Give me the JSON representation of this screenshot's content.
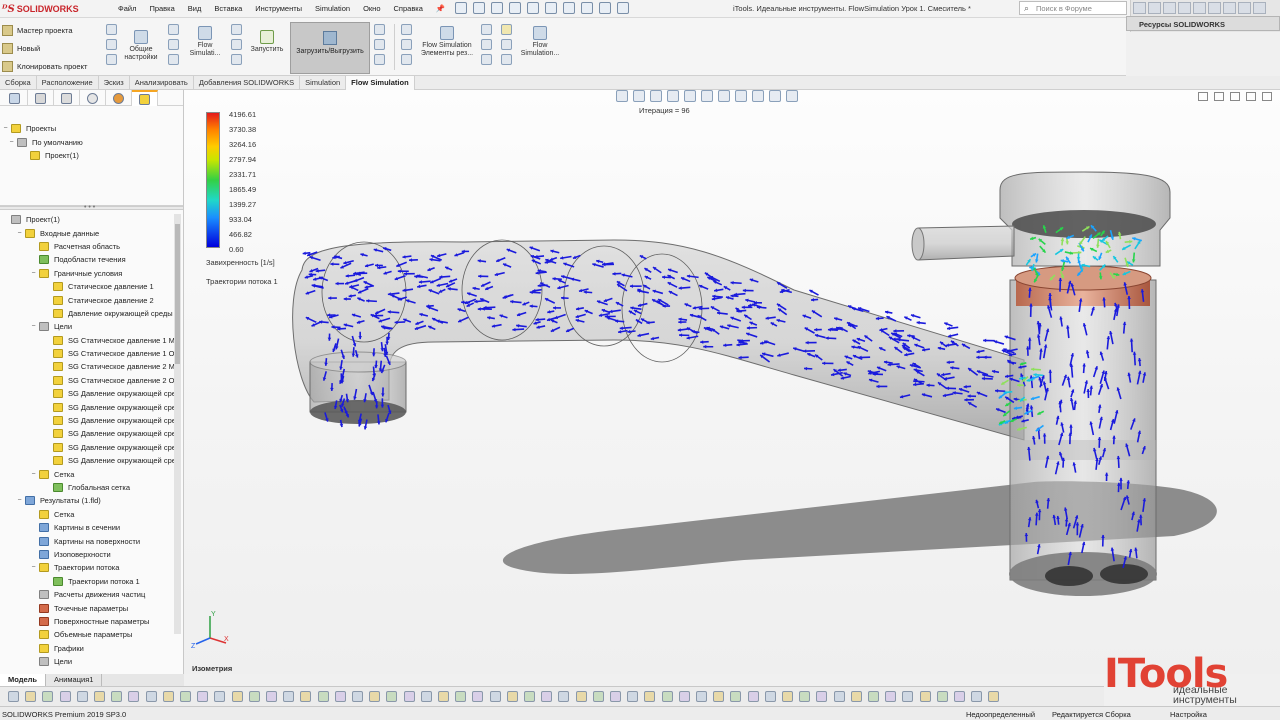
{
  "app": {
    "brand": "SOLIDWORKS",
    "window_title": "iTools. Идеальные инструменты. FlowSimulation Урок 1. Смеситель *"
  },
  "menu": [
    "Файл",
    "Правка",
    "Вид",
    "Вставка",
    "Инструменты",
    "Simulation",
    "Окно",
    "Справка"
  ],
  "search": {
    "placeholder": "Поиск в Форуме"
  },
  "resources_panel": {
    "label": "Ресурсы SOLIDWORKS"
  },
  "command_manager": {
    "left_commands": [
      "Мастер проекта",
      "Новый",
      "Клонировать проект"
    ],
    "general_settings": "Общие настройки",
    "flow_simulation": "Flow Simulati...",
    "run": "Запустить",
    "load_unload": "Загрузить/Выгрузить",
    "result_elements": "Flow Simulation Элементы рез...",
    "flow_simulation_2": "Flow Simulation..."
  },
  "tabs": [
    "Сборка",
    "Расположение",
    "Эскиз",
    "Анализировать",
    "Добавления SOLIDWORKS",
    "Simulation",
    "Flow Simulation"
  ],
  "active_tab": "Flow Simulation",
  "projects_panel": {
    "root": "Проекты",
    "default": "По умолчанию",
    "project": "Проект(1)"
  },
  "project_tree": [
    {
      "label": "Проект(1)",
      "level": 0,
      "icon": "gry",
      "exp": ""
    },
    {
      "label": "Входные данные",
      "level": 1,
      "icon": "yel",
      "exp": "−"
    },
    {
      "label": "Расчетная область",
      "level": 2,
      "icon": "yel",
      "exp": ""
    },
    {
      "label": "Подобласти течения",
      "level": 2,
      "icon": "grn",
      "exp": ""
    },
    {
      "label": "Граничные условия",
      "level": 2,
      "icon": "yel",
      "exp": "−"
    },
    {
      "label": "Статическое давление 1",
      "level": 3,
      "icon": "yel",
      "exp": ""
    },
    {
      "label": "Статическое давление 2",
      "level": 3,
      "icon": "yel",
      "exp": ""
    },
    {
      "label": "Давление окружающей среды",
      "level": 3,
      "icon": "yel",
      "exp": ""
    },
    {
      "label": "Цели",
      "level": 2,
      "icon": "gry",
      "exp": "−"
    },
    {
      "label": "SG Статическое давление 1 Ма",
      "level": 3,
      "icon": "yel",
      "exp": ""
    },
    {
      "label": "SG Статическое давление 1 Об",
      "level": 3,
      "icon": "yel",
      "exp": ""
    },
    {
      "label": "SG Статическое давление 2 Ма",
      "level": 3,
      "icon": "yel",
      "exp": ""
    },
    {
      "label": "SG Статическое давление 2 Об",
      "level": 3,
      "icon": "yel",
      "exp": ""
    },
    {
      "label": "SG Давление окружающей сре",
      "level": 3,
      "icon": "yel",
      "exp": ""
    },
    {
      "label": "SG Давление окружающей сре",
      "level": 3,
      "icon": "yel",
      "exp": ""
    },
    {
      "label": "SG Давление окружающей сре",
      "level": 3,
      "icon": "yel",
      "exp": ""
    },
    {
      "label": "SG Давление окружающей сре",
      "level": 3,
      "icon": "yel",
      "exp": ""
    },
    {
      "label": "SG Давление окружающей сре",
      "level": 3,
      "icon": "yel",
      "exp": ""
    },
    {
      "label": "SG Давление окружающей сре",
      "level": 3,
      "icon": "yel",
      "exp": ""
    },
    {
      "label": "Сетка",
      "level": 2,
      "icon": "yel",
      "exp": "−"
    },
    {
      "label": "Глобальная сетка",
      "level": 3,
      "icon": "grn",
      "exp": ""
    },
    {
      "label": "Результаты (1.fld)",
      "level": 1,
      "icon": "blu",
      "exp": "−"
    },
    {
      "label": "Сетка",
      "level": 2,
      "icon": "yel",
      "exp": ""
    },
    {
      "label": "Картины в сечении",
      "level": 2,
      "icon": "blu",
      "exp": ""
    },
    {
      "label": "Картины на поверхности",
      "level": 2,
      "icon": "blu",
      "exp": ""
    },
    {
      "label": "Изоповерхности",
      "level": 2,
      "icon": "blu",
      "exp": ""
    },
    {
      "label": "Траектории потока",
      "level": 2,
      "icon": "yel",
      "exp": "−"
    },
    {
      "label": "Траектории потока 1",
      "level": 3,
      "icon": "grn",
      "exp": ""
    },
    {
      "label": "Расчеты движения частиц",
      "level": 2,
      "icon": "gry",
      "exp": ""
    },
    {
      "label": "Точечные параметры",
      "level": 2,
      "icon": "red",
      "exp": ""
    },
    {
      "label": "Поверхностные параметры",
      "level": 2,
      "icon": "red",
      "exp": ""
    },
    {
      "label": "Объемные параметры",
      "level": 2,
      "icon": "yel",
      "exp": ""
    },
    {
      "label": "Графики",
      "level": 2,
      "icon": "yel",
      "exp": ""
    },
    {
      "label": "Цели",
      "level": 2,
      "icon": "gry",
      "exp": ""
    },
    {
      "label": "Отчет",
      "level": 2,
      "icon": "gry",
      "exp": ""
    }
  ],
  "bottom_tabs": [
    "Модель",
    "Анимация1"
  ],
  "viewport": {
    "iteration": "Итерация = 96",
    "legend_values": [
      "4196.61",
      "3730.38",
      "3264.16",
      "2797.94",
      "2331.71",
      "1865.49",
      "1399.27",
      "933.04",
      "466.82",
      "0.60"
    ],
    "legend_unit": "Завихренность [1/s]",
    "trajectory_label": "Траектории потока 1",
    "view_name": "Изометрия",
    "triad": {
      "x": "X",
      "y": "Y",
      "z": "Z"
    }
  },
  "watermark": {
    "logo": "ITools",
    "line1": "идеальные",
    "line2": "инструменты"
  },
  "status": {
    "version": "SOLIDWORKS Premium 2019 SP3.0",
    "definition": "Недоопределенный",
    "editing": "Редактируется Сборка",
    "custom": "Настройка"
  },
  "colors": {
    "accent_red": "#e14234",
    "arrow_blue": "#1a1adc",
    "tab_active_marker": "#f5a623"
  }
}
